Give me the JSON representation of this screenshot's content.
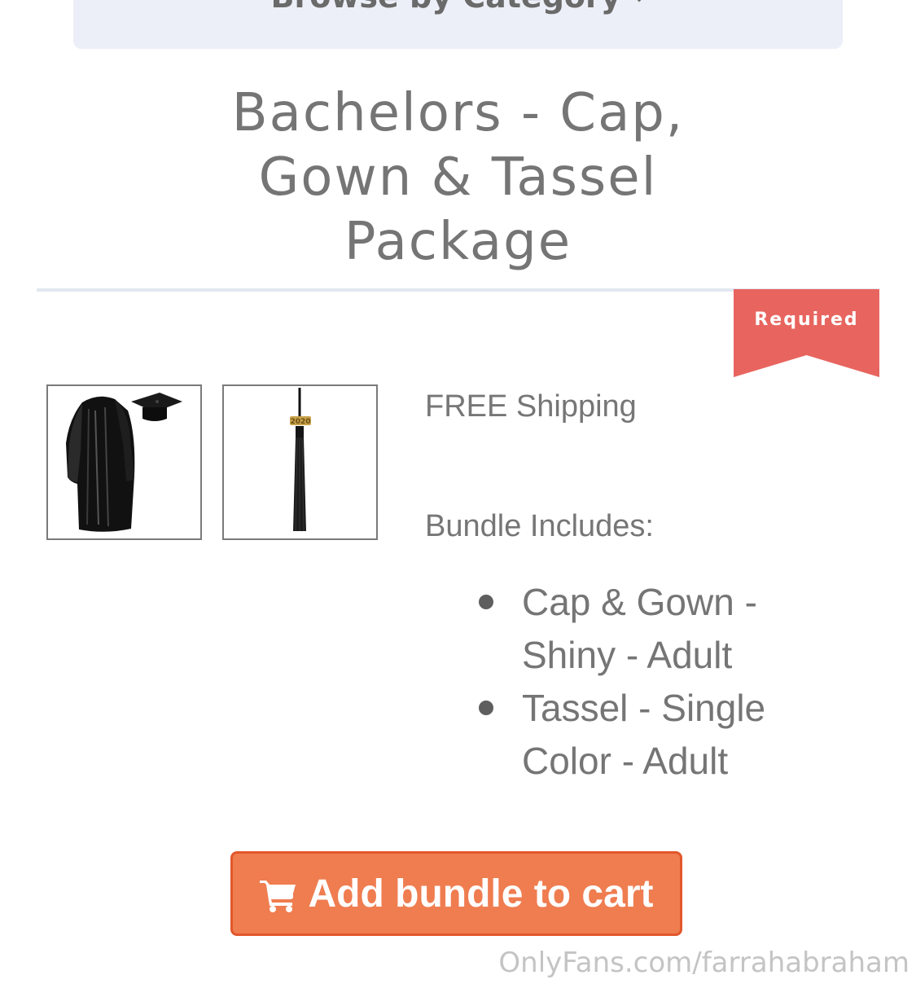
{
  "category_bar": {
    "label": "Browse by Category"
  },
  "product": {
    "title": "Bachelors - Cap, Gown & Tassel Package",
    "badge": "Required",
    "shipping": "FREE Shipping",
    "bundle_label": "Bundle Includes:",
    "bundle_items": [
      "Cap & Gown - Shiny - Adult",
      "Tassel - Single Color - Adult"
    ],
    "tassel_year": "2020"
  },
  "actions": {
    "add_to_cart_label": "Add bundle to cart",
    "add_to_cart_icon": "shopping-cart-icon"
  },
  "watermark": "OnlyFans.com/farrahabraham",
  "colors": {
    "button": "#ef7d50",
    "button_border": "#e2572c",
    "badge": "#e8655f",
    "divider": "#e3e7f2",
    "category_bar": "#eceff7",
    "text": "#757575"
  }
}
